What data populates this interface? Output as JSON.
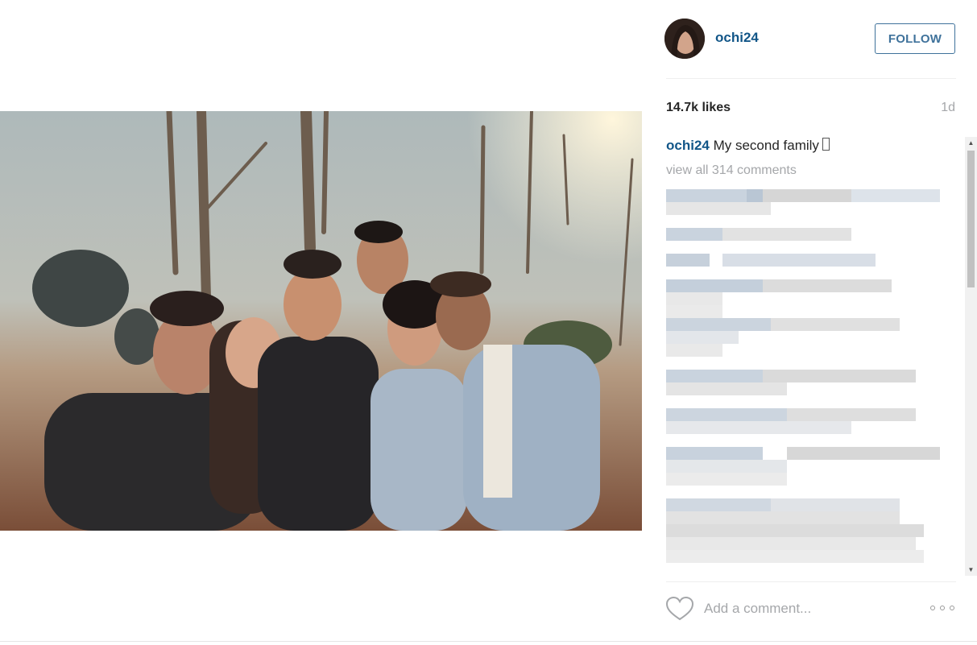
{
  "post": {
    "username": "ochi24",
    "follow_label": "FOLLOW",
    "likes": "14.7k likes",
    "age": "1d",
    "caption_user": "ochi24",
    "caption_text": "My second family",
    "view_all": "view all 314 comments",
    "comment_placeholder": "Add a comment..."
  },
  "icons": {
    "like": "heart-outline-icon",
    "more": "more-options-icon"
  },
  "colors": {
    "username": "#125688",
    "follow_border": "#3f729b",
    "muted": "#a5a7aa",
    "text": "#262626"
  }
}
